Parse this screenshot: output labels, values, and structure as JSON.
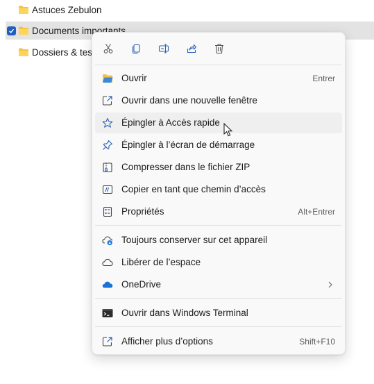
{
  "files": [
    {
      "name": "Astuces Zebulon",
      "selected": false
    },
    {
      "name": "Documents importants",
      "selected": true
    },
    {
      "name": "Dossiers & tests",
      "selected": false
    }
  ],
  "quick_actions": [
    {
      "name": "cut-icon"
    },
    {
      "name": "copy-icon"
    },
    {
      "name": "rename-icon"
    },
    {
      "name": "share-icon"
    },
    {
      "name": "delete-icon"
    }
  ],
  "menu": {
    "items": [
      {
        "label": "Ouvrir",
        "shortcut": "Entrer",
        "icon": "folder-open-icon"
      },
      {
        "label": "Ouvrir dans une nouvelle fenêtre",
        "shortcut": "",
        "icon": "open-new-window-icon"
      },
      {
        "label": "Épingler à Accès rapide",
        "shortcut": "",
        "icon": "star-icon"
      },
      {
        "label": "Épingler à l’écran de démarrage",
        "shortcut": "",
        "icon": "pin-icon"
      },
      {
        "label": "Compresser dans le fichier ZIP",
        "shortcut": "",
        "icon": "zip-icon"
      },
      {
        "label": "Copier en tant que chemin d’accès",
        "shortcut": "",
        "icon": "copy-path-icon"
      },
      {
        "label": "Propriétés",
        "shortcut": "Alt+Entrer",
        "icon": "properties-icon"
      },
      {
        "label": "Toujours conserver sur cet appareil",
        "shortcut": "",
        "icon": "cloud-download-icon"
      },
      {
        "label": "Libérer de l’espace",
        "shortcut": "",
        "icon": "cloud-icon"
      },
      {
        "label": "OneDrive",
        "shortcut": "",
        "icon": "onedrive-icon"
      },
      {
        "label": "Ouvrir dans Windows Terminal",
        "shortcut": "",
        "icon": "terminal-icon"
      },
      {
        "label": "Afficher plus d’options",
        "shortcut": "Shift+F10",
        "icon": "more-options-icon"
      }
    ]
  },
  "colors": {
    "accent": "#1f5fbf",
    "folder": "#f5c242",
    "onedrive": "#1a73d6",
    "icon_stroke": "#2a62b8"
  }
}
